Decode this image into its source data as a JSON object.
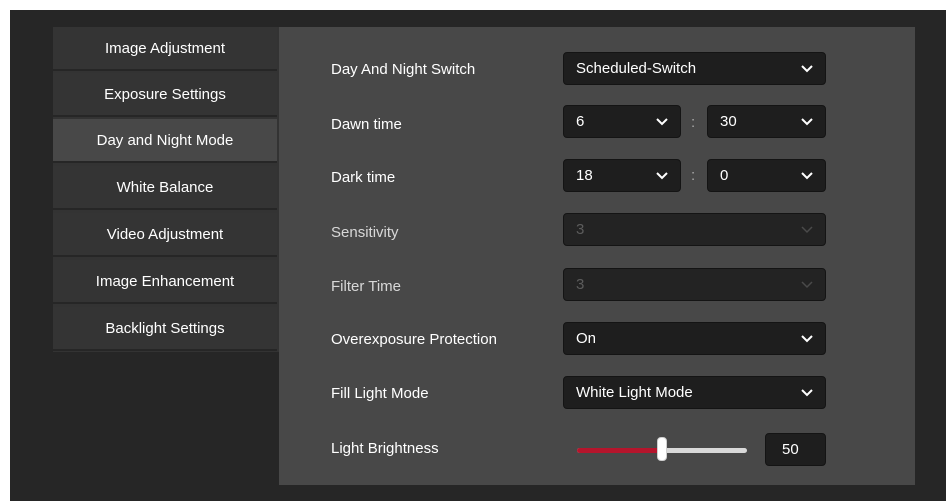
{
  "sidebar": {
    "items": [
      {
        "label": "Image Adjustment"
      },
      {
        "label": "Exposure Settings"
      },
      {
        "label": "Day and Night Mode"
      },
      {
        "label": "White Balance"
      },
      {
        "label": "Video Adjustment"
      },
      {
        "label": "Image Enhancement"
      },
      {
        "label": "Backlight Settings"
      }
    ],
    "active_index": 2
  },
  "settings": {
    "day_night_switch": {
      "label": "Day And Night Switch",
      "value": "Scheduled-Switch"
    },
    "dawn_time": {
      "label": "Dawn time",
      "hour": "6",
      "minute": "30",
      "separator": ":"
    },
    "dark_time": {
      "label": "Dark time",
      "hour": "18",
      "minute": "0",
      "separator": ":"
    },
    "sensitivity": {
      "label": "Sensitivity",
      "value": "3",
      "disabled": true
    },
    "filter_time": {
      "label": "Filter Time",
      "value": "3",
      "disabled": true
    },
    "overexposure_protection": {
      "label": "Overexposure Protection",
      "value": "On"
    },
    "fill_light_mode": {
      "label": "Fill Light Mode",
      "value": "White Light Mode"
    },
    "light_brightness": {
      "label": "Light Brightness",
      "value": "50",
      "fraction": 0.5
    }
  },
  "colors": {
    "accent": "#b5152c",
    "panel_bg": "#484848",
    "sidebar_bg": "#343434",
    "frame_bg": "#262626"
  },
  "icons": {
    "dropdown": "chevron-down-icon"
  }
}
